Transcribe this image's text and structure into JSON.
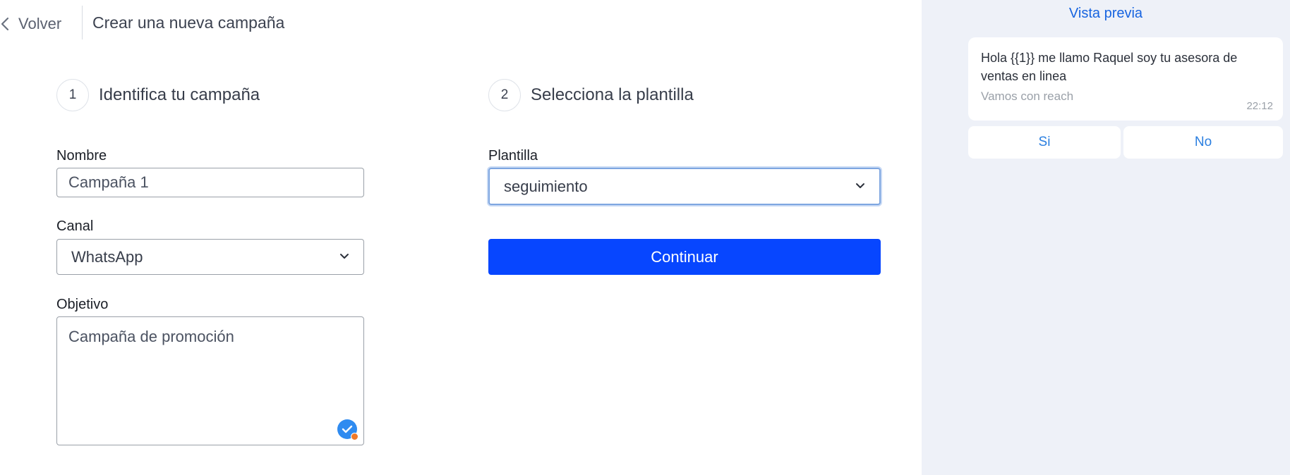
{
  "header": {
    "back_label": "Volver",
    "title": "Crear una nueva campaña"
  },
  "step1": {
    "number": "1",
    "title": "Identifica tu campaña",
    "nombre_label": "Nombre",
    "nombre_value": "Campaña 1",
    "canal_label": "Canal",
    "canal_value": "WhatsApp",
    "objetivo_label": "Objetivo",
    "objetivo_value": "Campaña de promoción"
  },
  "step2": {
    "number": "2",
    "title": "Selecciona la plantilla",
    "plantilla_label": "Plantilla",
    "plantilla_value": "seguimiento",
    "continue_label": "Continuar"
  },
  "preview": {
    "title": "Vista previa",
    "message_body": "Hola {{1}} me llamo Raquel soy tu asesora de ventas en linea",
    "message_footer": "Vamos con reach",
    "message_time": "22:12",
    "quick_replies": [
      "Si",
      "No"
    ]
  },
  "colors": {
    "primary_button": "#0746ff",
    "preview_background": "#eef1f8",
    "link_blue": "#1764e0"
  },
  "icons": {
    "back": "chevron-left-icon",
    "select": "chevron-down-icon",
    "grammar": "grammar-check-icon"
  }
}
